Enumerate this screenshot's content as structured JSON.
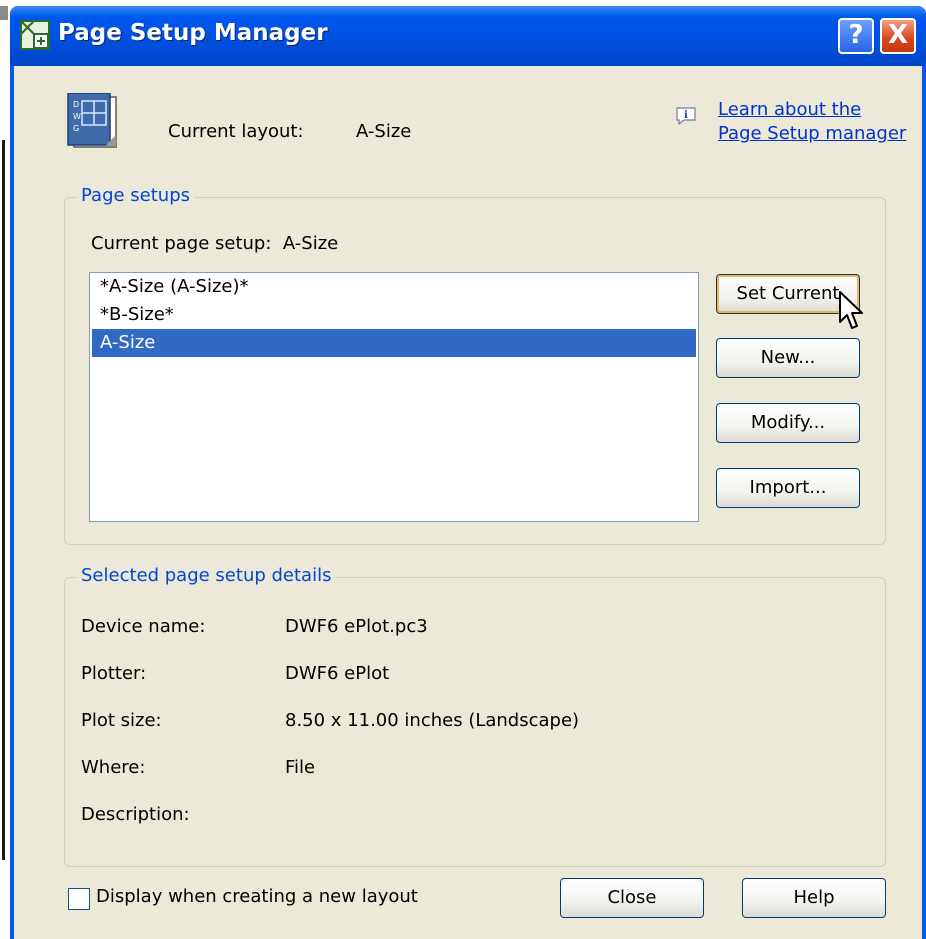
{
  "window": {
    "title": "Page Setup Manager",
    "help_glyph": "?",
    "close_glyph": "X"
  },
  "header": {
    "current_layout_label": "Current layout:",
    "current_layout_value": "A-Size",
    "learn_link_line1": "Learn about the",
    "learn_link_line2": "Page Setup manager"
  },
  "page_setups": {
    "legend": "Page setups",
    "current_label": "Current page setup:",
    "current_value": "A-Size",
    "items": [
      {
        "label": "*A-Size (A-Size)*",
        "selected": false
      },
      {
        "label": "*B-Size*",
        "selected": false
      },
      {
        "label": "A-Size",
        "selected": true
      }
    ],
    "buttons": {
      "set_current": "Set Current",
      "new": "New...",
      "modify": "Modify...",
      "import": "Import..."
    }
  },
  "details": {
    "legend": "Selected page setup details",
    "rows": [
      {
        "label": "Device name:",
        "value": "DWF6 ePlot.pc3"
      },
      {
        "label": "Plotter:",
        "value": "DWF6 ePlot"
      },
      {
        "label": "Plot size:",
        "value": "8.50 x 11.00 inches (Landscape)"
      },
      {
        "label": "Where:",
        "value": "File"
      },
      {
        "label": "Description:",
        "value": ""
      }
    ]
  },
  "footer": {
    "checkbox_label": "Display when creating a new layout",
    "checkbox_checked": false,
    "close_label": "Close",
    "help_label": "Help"
  },
  "icons": {
    "app": "page-setup-app-icon",
    "layout": "dwg-layout-icon",
    "info": "info-icon",
    "cursor": "mouse-pointer-icon"
  },
  "colors": {
    "titlebar": "#0058ee",
    "dialog_bg": "#ece9d8",
    "selection": "#316ac5",
    "legend_text": "#0046d5",
    "link": "#0033cc"
  }
}
